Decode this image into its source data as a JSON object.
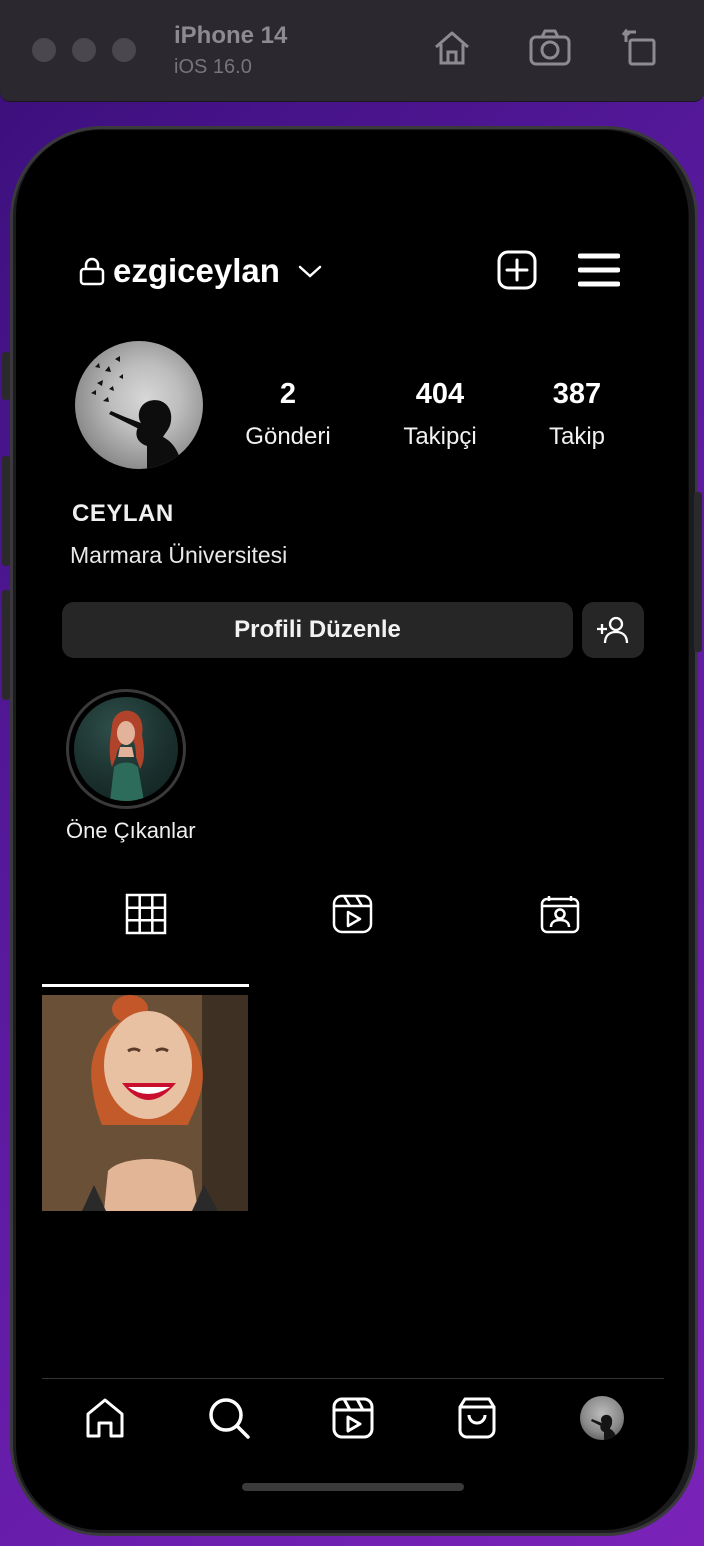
{
  "simulator": {
    "device_name": "iPhone 14",
    "os_version": "iOS 16.0",
    "icons": [
      "home-icon",
      "screenshot-icon",
      "rotate-icon"
    ]
  },
  "profile": {
    "username": "ezgiceylan",
    "display_name": "CEYLAN",
    "bio": "Marmara Üniversitesi",
    "stats": [
      {
        "value": "2",
        "label": "Gönderi"
      },
      {
        "value": "404",
        "label": "Takipçi"
      },
      {
        "value": "387",
        "label": "Takip"
      }
    ],
    "edit_button_label": "Profili Düzenle"
  },
  "highlights": [
    {
      "label": "Öne Çıkanlar"
    }
  ],
  "tabs": [
    {
      "icon": "grid-icon",
      "active": true
    },
    {
      "icon": "reels-icon",
      "active": false
    },
    {
      "icon": "tagged-icon",
      "active": false
    }
  ],
  "bottom_nav": [
    "home-icon",
    "search-icon",
    "reels-icon",
    "shop-icon",
    "profile-avatar"
  ],
  "colors": {
    "background": "#000000",
    "button_bg": "#262626",
    "text": "#ffffff",
    "desktop_accent": "#5a1aa0"
  }
}
